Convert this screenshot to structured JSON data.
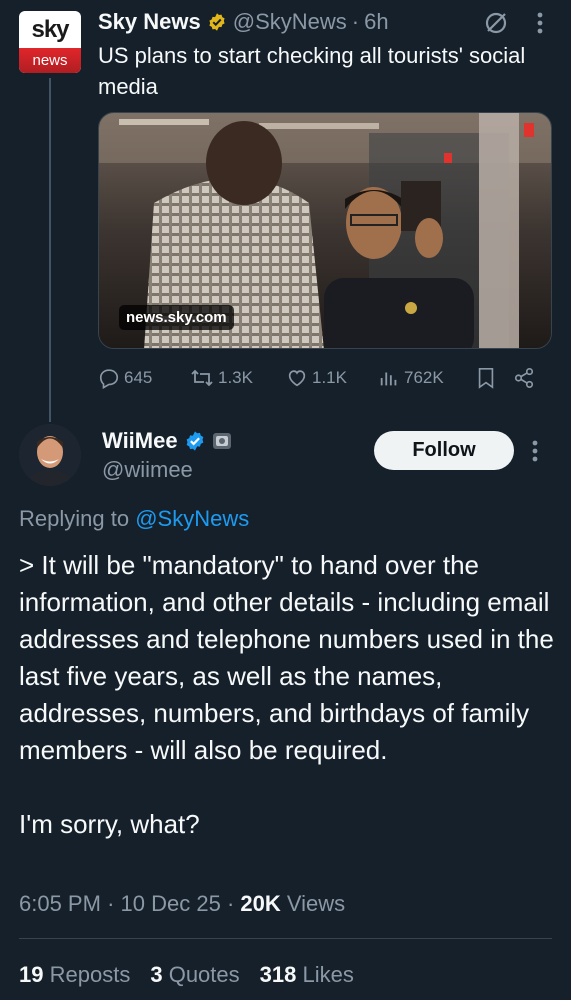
{
  "quoted_tweet": {
    "logo_top": "sky",
    "logo_bottom": "news",
    "author_name": "Sky News",
    "author_handle": "@SkyNews",
    "separator": "·",
    "time_ago": "6h",
    "text": "US plans to start checking all tourists' social media",
    "media_domain": "news.sky.com",
    "replies": "645",
    "reposts": "1.3K",
    "likes": "1.1K",
    "views": "762K"
  },
  "main_tweet": {
    "author_name": "WiiMee",
    "author_handle": "@wiimee",
    "follow_label": "Follow",
    "replying_prefix": "Replying to",
    "replying_to": "@SkyNews",
    "body_paragraph_1": "> It will be \"mandatory\" to hand over the information, and other details - including email addresses and telephone numbers used in the last five years, as well as the names, addresses, numbers, and birthdays of family members - will also be required.",
    "body_paragraph_2": "I'm sorry, what?",
    "time": "6:05 PM",
    "date": "10 Dec 25",
    "views_count": "20K",
    "views_label": "Views",
    "reposts_count": "19",
    "reposts_label": "Reposts",
    "quotes_count": "3",
    "quotes_label": "Quotes",
    "likes_count": "318",
    "likes_label": "Likes"
  },
  "colors": {
    "background": "#15202b",
    "accent_blue": "#1d9bf0",
    "muted_text": "#8b98a5",
    "verified_gold": "#e2b719",
    "verified_blue": "#1d9bf0"
  },
  "icons": [
    "verified-gold-badge-icon",
    "grok-icon",
    "more-icon",
    "reply-icon",
    "repost-icon",
    "like-icon",
    "views-icon",
    "bookmark-icon",
    "share-icon",
    "verified-blue-badge-icon",
    "affiliate-badge-icon"
  ]
}
